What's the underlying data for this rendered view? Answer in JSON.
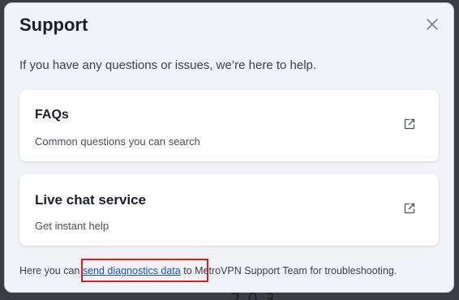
{
  "dialog": {
    "title": "Support",
    "subtitle": "If you have any questions or issues, we’re here to help.",
    "close_icon": "close-icon"
  },
  "cards": [
    {
      "title": "FAQs",
      "description": "Common questions you can search",
      "icon": "external-link-icon"
    },
    {
      "title": "Live chat service",
      "description": "Get instant help",
      "icon": "external-link-icon"
    }
  ],
  "footer": {
    "prefix": "Here you can ",
    "link_text": "send diagnostics data",
    "suffix": " to MetroVPN Support Team for troubleshooting."
  },
  "backdrop": {
    "partial_text": "2 0 3"
  },
  "colors": {
    "dialog_bg": "#f1f3f8",
    "card_bg": "#ffffff",
    "link": "#1f4fd0",
    "highlight_box": "#e01b1b"
  }
}
